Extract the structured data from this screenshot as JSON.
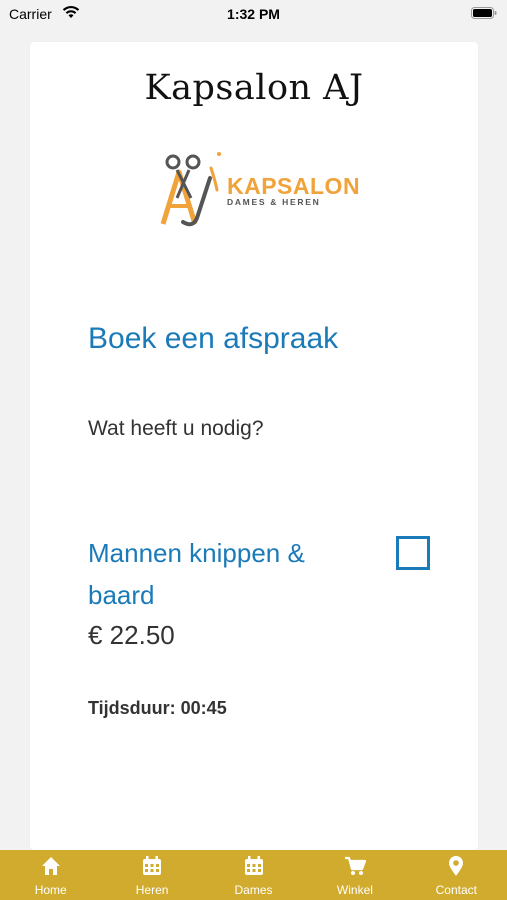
{
  "status_bar": {
    "carrier": "Carrier",
    "time": "1:32 PM"
  },
  "header": {
    "title": "Kapsalon AJ",
    "logo": {
      "word": "KAPSALON",
      "subtitle": "DAMES & HEREN",
      "colors": {
        "accent": "#f0a33a",
        "text": "#555555"
      }
    }
  },
  "booking": {
    "title": "Boek een afspraak",
    "question": "Wat heeft u nodig?",
    "service": {
      "name": "Mannen knippen & baard",
      "price": "€ 22.50",
      "duration": "Tijdsduur: 00:45",
      "checked": false
    }
  },
  "tab_bar": {
    "background": "#d1ab2e",
    "items": [
      {
        "label": "Home",
        "icon": "home-icon"
      },
      {
        "label": "Heren",
        "icon": "calendar-icon"
      },
      {
        "label": "Dames",
        "icon": "calendar-icon"
      },
      {
        "label": "Winkel",
        "icon": "cart-icon"
      },
      {
        "label": "Contact",
        "icon": "location-pin-icon"
      }
    ]
  },
  "colors": {
    "link_blue": "#1b7ab8",
    "background": "#f2f2f2"
  }
}
